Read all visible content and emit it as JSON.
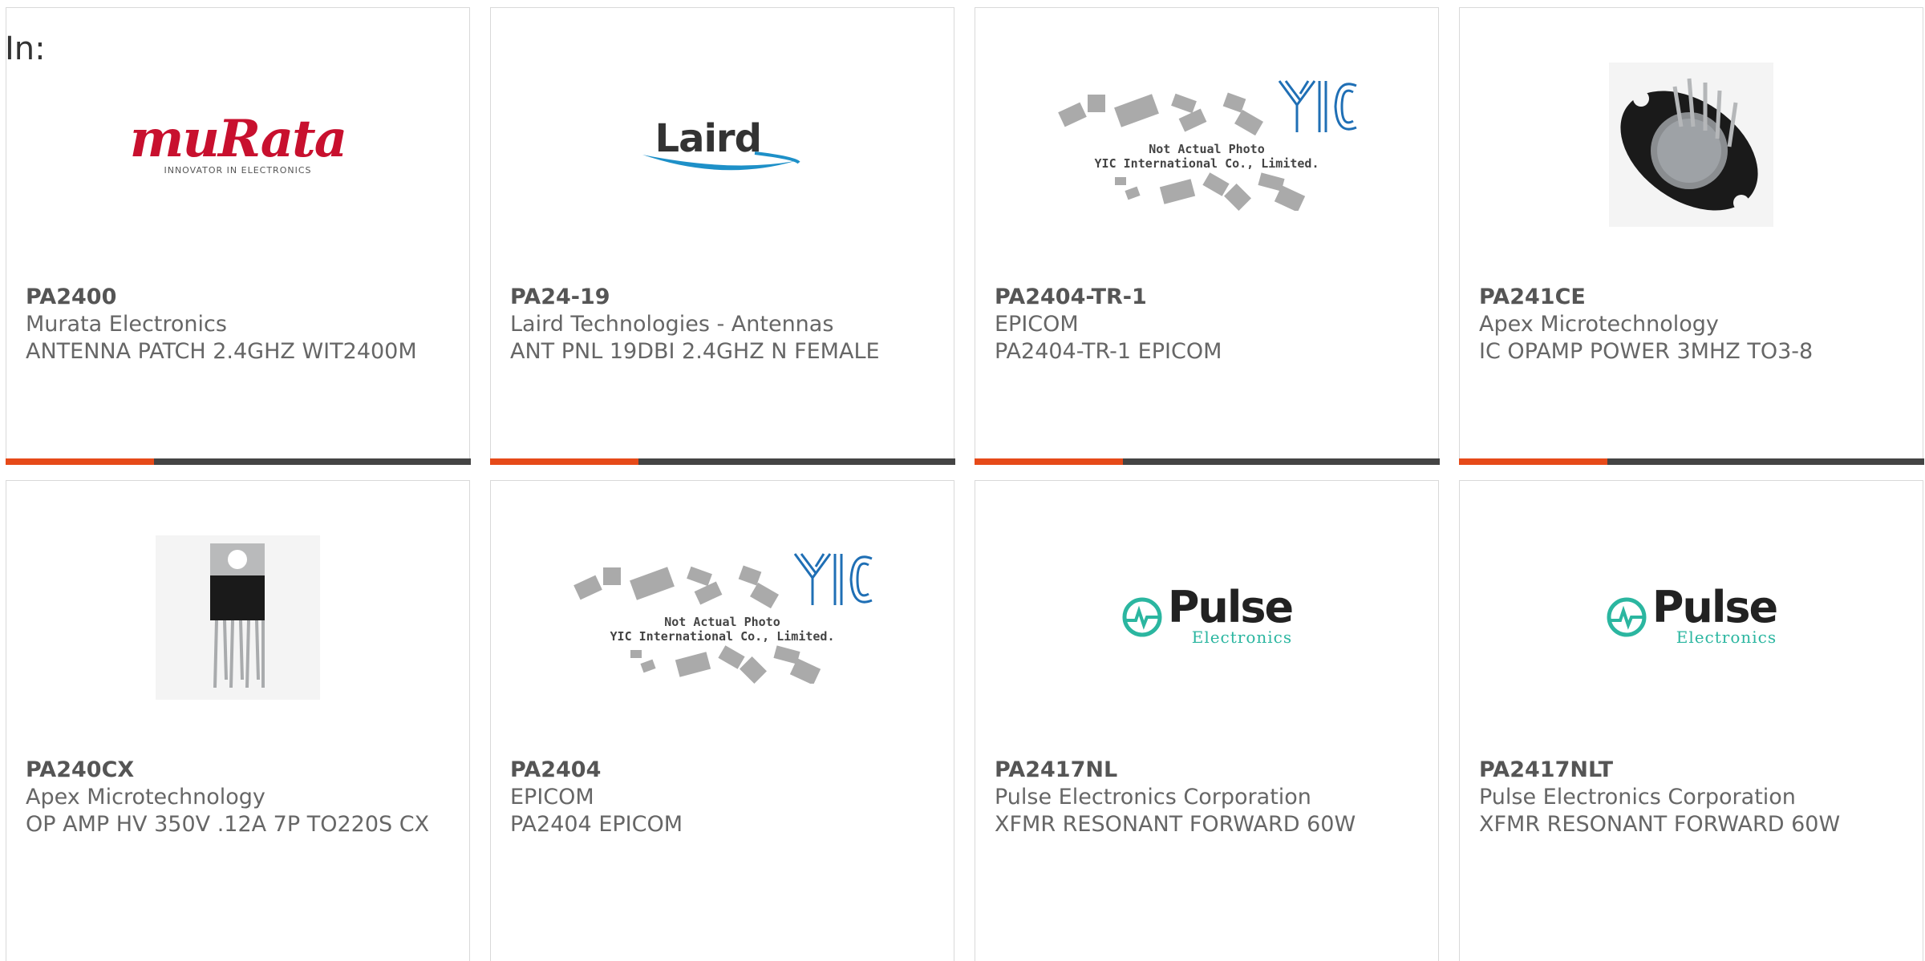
{
  "header": {
    "label": "In:"
  },
  "colors": {
    "accent": "#e64a19",
    "bar": "#444444",
    "border": "#d9d9d9",
    "text": "#666666"
  },
  "products": [
    {
      "part": "PA2400",
      "maker": "Murata Electronics",
      "desc": "ANTENNA PATCH 2.4GHZ WIT2400M",
      "image": "murata-logo",
      "logo": {
        "word": "muRata",
        "tag": "INNOVATOR IN ELECTRONICS"
      }
    },
    {
      "part": "PA24-19",
      "maker": "Laird Technologies - Antennas",
      "desc": "ANT PNL 19DBI 2.4GHZ N FEMALE",
      "image": "laird-logo",
      "logo": {
        "word": "Laird"
      }
    },
    {
      "part": "PA2404-TR-1",
      "maker": "EPICOM",
      "desc": "PA2404-TR-1 EPICOM",
      "image": "yic-placeholder",
      "logo": {
        "line1": "Not Actual Photo",
        "line2": "YIC International Co., Limited."
      }
    },
    {
      "part": "PA241CE",
      "maker": "Apex Microtechnology",
      "desc": "IC OPAMP POWER 3MHZ TO3-8",
      "image": "to3-package-photo"
    },
    {
      "part": "PA240CX",
      "maker": "Apex Microtechnology",
      "desc": "OP AMP HV 350V .12A 7P TO220S CX",
      "image": "to220-package-photo"
    },
    {
      "part": "PA2404",
      "maker": "EPICOM",
      "desc": "PA2404 EPICOM",
      "image": "yic-placeholder",
      "logo": {
        "line1": "Not Actual Photo",
        "line2": "YIC International Co., Limited."
      }
    },
    {
      "part": "PA2417NL",
      "maker": "Pulse Electronics Corporation",
      "desc": "XFMR RESONANT FORWARD 60W",
      "image": "pulse-logo",
      "logo": {
        "word": "Pulse",
        "sub": "Electronics"
      }
    },
    {
      "part": "PA2417NLT",
      "maker": "Pulse Electronics Corporation",
      "desc": "XFMR RESONANT FORWARD 60W",
      "image": "pulse-logo",
      "logo": {
        "word": "Pulse",
        "sub": "Electronics"
      }
    }
  ]
}
